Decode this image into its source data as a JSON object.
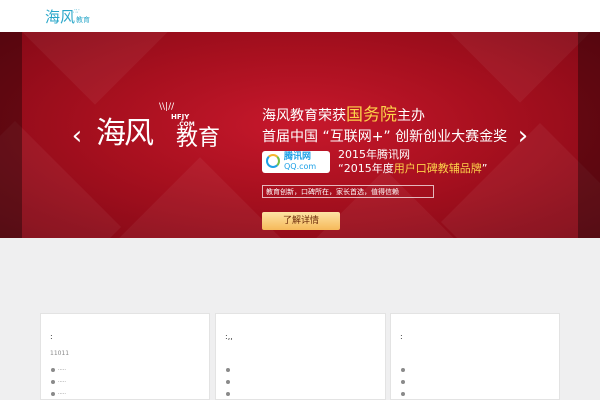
{
  "header": {
    "logo_main": "海风",
    "logo_sub": "教育",
    "logo_dots": "∴∵"
  },
  "banner": {
    "prev_icon": "‹",
    "next_icon": "›",
    "logo_main": "海风",
    "logo_sub": "教育",
    "logo_tag1": "HFJY",
    "logo_tag2": ".COM",
    "logo_rays": "\\\\|//",
    "line1_a": "海风教育荣获",
    "line1_hl": "国务院",
    "line1_b": "主办",
    "line2": "首届中国 “互联网+” 创新创业大赛金奖",
    "qq_logo_text1": "腾讯网",
    "qq_logo_text2": "QQ.com",
    "award_line1": "2015年腾讯网",
    "award_line2_a": "“2015年度",
    "award_line2_hl": "用户口碑教辅品牌",
    "award_line2_b": "”",
    "slogan": "教育创新，口碑所在，家长首选，值得信赖",
    "cta_label": "了解详情",
    "dots": [
      true,
      false,
      false
    ]
  },
  "cards": [
    {
      "title": ":",
      "subtitle": "11011",
      "items": [
        "·····",
        "·····",
        "·····"
      ]
    },
    {
      "title": ":,,",
      "subtitle": "",
      "items": [
        "",
        "",
        ""
      ]
    },
    {
      "title": ":",
      "subtitle": "",
      "items": [
        "",
        "",
        ""
      ]
    }
  ],
  "colors": {
    "brand_teal": "#2aa7c9",
    "banner_red": "#b3111f",
    "highlight_gold": "#fdd24a",
    "active_dot": "#2d6fd1"
  }
}
